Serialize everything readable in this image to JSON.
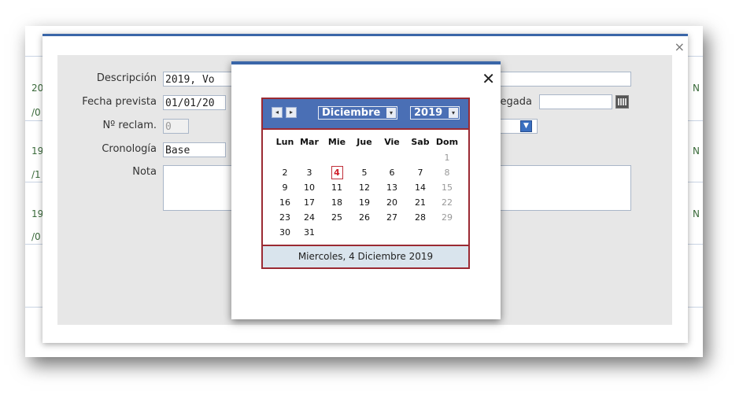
{
  "background": {
    "left_rows": [
      "20",
      "/0",
      "19",
      "/1",
      "19",
      "/0"
    ],
    "right_rows": [
      "N",
      "N",
      "N"
    ]
  },
  "dialog": {
    "close_icon": "×",
    "fields": {
      "descripcion_label": "Descripción",
      "descripcion_value": "2019, Vo",
      "fecha_prevista_label": "Fecha prevista",
      "fecha_prevista_value": "01/01/20",
      "fecha_llegada_label": "a llegada",
      "fecha_llegada_value": "",
      "reclam_label": "Nº reclam.",
      "reclam_value": "0",
      "cronologia_label": "Cronología",
      "cronologia_value": "Base",
      "nota_label": "Nota",
      "nota_value": ""
    }
  },
  "datepicker": {
    "close_icon": "✕",
    "prev_icon": "◂",
    "next_icon": "▸",
    "month": "Diciembre",
    "year": "2019",
    "dropdown_icon": "▾",
    "weekdays": [
      "Lun",
      "Mar",
      "Mie",
      "Jue",
      "Vie",
      "Sab",
      "Dom"
    ],
    "weeks": [
      [
        "",
        "",
        "",
        "",
        "",
        "",
        "1"
      ],
      [
        "2",
        "3",
        "4",
        "5",
        "6",
        "7",
        "8"
      ],
      [
        "9",
        "10",
        "11",
        "12",
        "13",
        "14",
        "15"
      ],
      [
        "16",
        "17",
        "18",
        "19",
        "20",
        "21",
        "22"
      ],
      [
        "23",
        "24",
        "25",
        "26",
        "27",
        "28",
        "29"
      ],
      [
        "30",
        "31",
        "",
        "",
        "",
        "",
        ""
      ]
    ],
    "selected_day": "4",
    "footer": "Miercoles, 4 Diciembre 2019",
    "colors": {
      "header": "#4a6fb5",
      "border": "#9b2a33",
      "today": "#d0202a",
      "footer_bg": "#d9e4ed"
    }
  }
}
